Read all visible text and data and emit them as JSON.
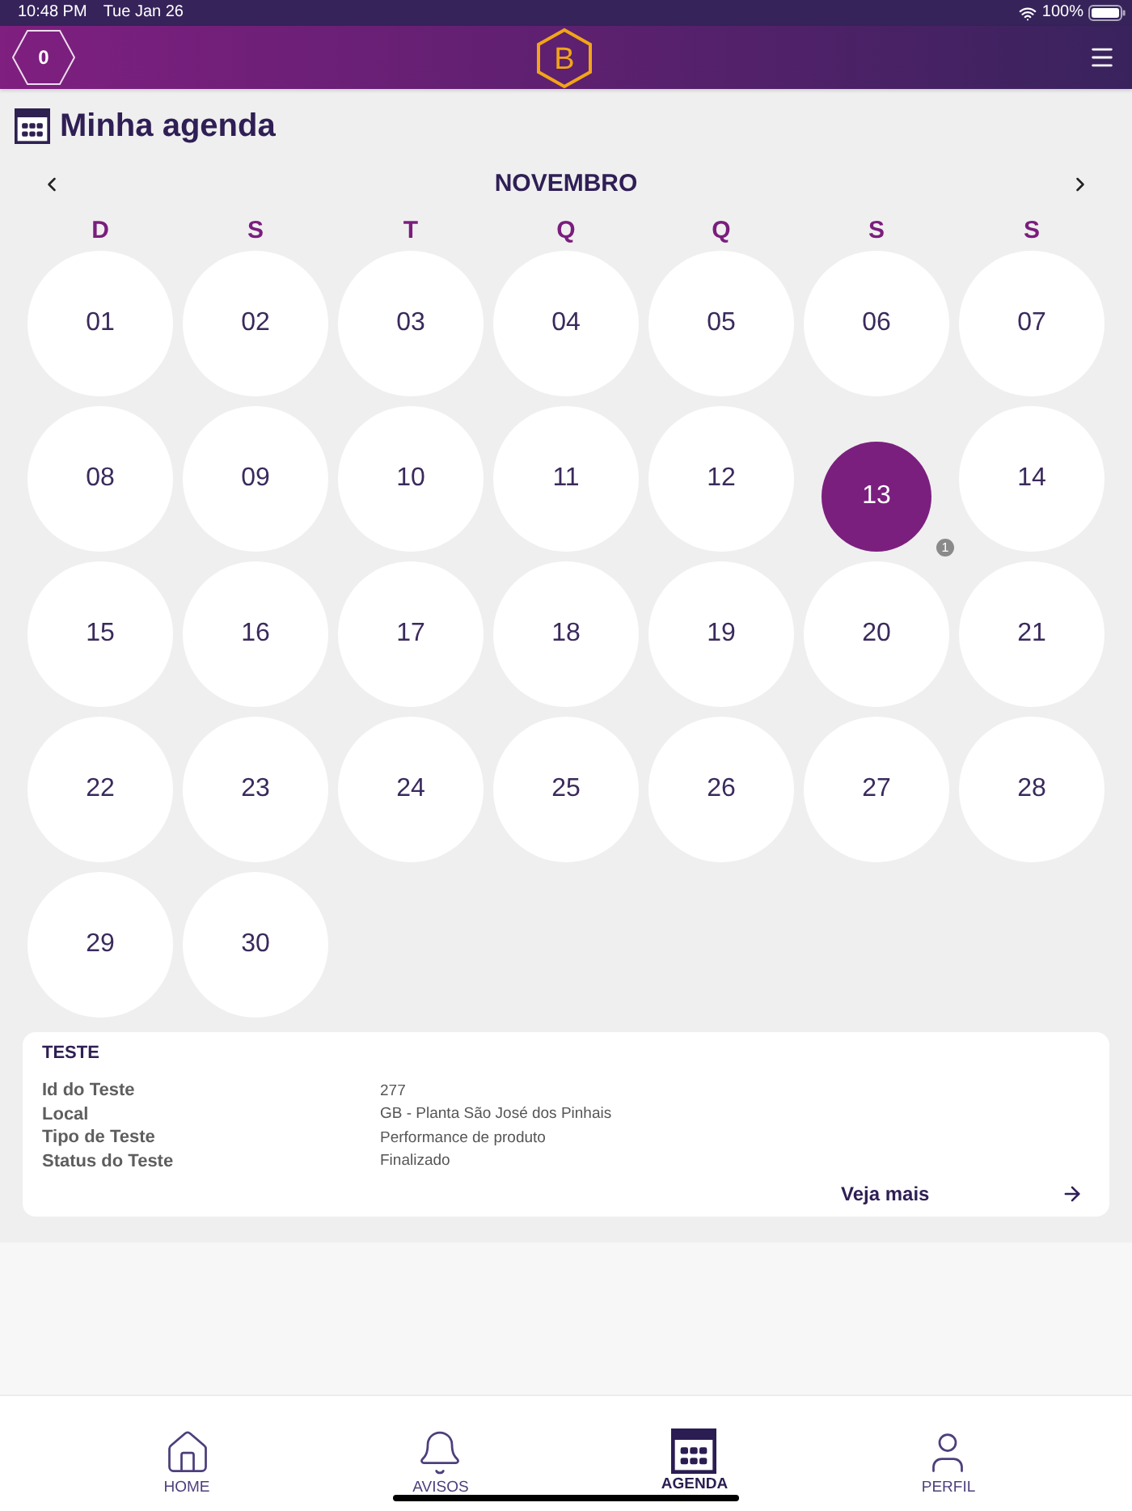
{
  "status_bar": {
    "time": "10:48 PM",
    "date": "Tue Jan 26",
    "battery": "100%"
  },
  "header": {
    "points": "0",
    "logo": "B"
  },
  "page": {
    "title": "Minha agenda"
  },
  "calendar": {
    "month": "NOVEMBRO",
    "weekdays": [
      "D",
      "S",
      "T",
      "Q",
      "Q",
      "S",
      "S"
    ],
    "days": [
      {
        "label": "01",
        "selected": false
      },
      {
        "label": "02",
        "selected": false
      },
      {
        "label": "03",
        "selected": false
      },
      {
        "label": "04",
        "selected": false
      },
      {
        "label": "05",
        "selected": false
      },
      {
        "label": "06",
        "selected": false
      },
      {
        "label": "07",
        "selected": false
      },
      {
        "label": "08",
        "selected": false
      },
      {
        "label": "09",
        "selected": false
      },
      {
        "label": "10",
        "selected": false
      },
      {
        "label": "11",
        "selected": false
      },
      {
        "label": "12",
        "selected": false
      },
      {
        "label": "13",
        "selected": true,
        "events": "1"
      },
      {
        "label": "14",
        "selected": false
      },
      {
        "label": "15",
        "selected": false
      },
      {
        "label": "16",
        "selected": false
      },
      {
        "label": "17",
        "selected": false
      },
      {
        "label": "18",
        "selected": false
      },
      {
        "label": "19",
        "selected": false
      },
      {
        "label": "20",
        "selected": false
      },
      {
        "label": "21",
        "selected": false
      },
      {
        "label": "22",
        "selected": false
      },
      {
        "label": "23",
        "selected": false
      },
      {
        "label": "24",
        "selected": false
      },
      {
        "label": "25",
        "selected": false
      },
      {
        "label": "26",
        "selected": false
      },
      {
        "label": "27",
        "selected": false
      },
      {
        "label": "28",
        "selected": false
      },
      {
        "label": "29",
        "selected": false
      },
      {
        "label": "30",
        "selected": false
      }
    ]
  },
  "event_card": {
    "title": "TESTE",
    "fields": [
      {
        "label": "Id do Teste",
        "value": "277"
      },
      {
        "label": "Local",
        "value": "GB - Planta São José dos Pinhais"
      },
      {
        "label": "Tipo de Teste",
        "value": "Performance de produto"
      },
      {
        "label": "Status do Teste",
        "value": "Finalizado"
      }
    ],
    "link": "Veja mais"
  },
  "tab_bar": {
    "tabs": [
      {
        "label": "HOME",
        "selected": false
      },
      {
        "label": "AVISOS",
        "selected": false
      },
      {
        "label": "AGENDA",
        "selected": true
      },
      {
        "label": "PERFIL",
        "selected": false
      }
    ]
  }
}
